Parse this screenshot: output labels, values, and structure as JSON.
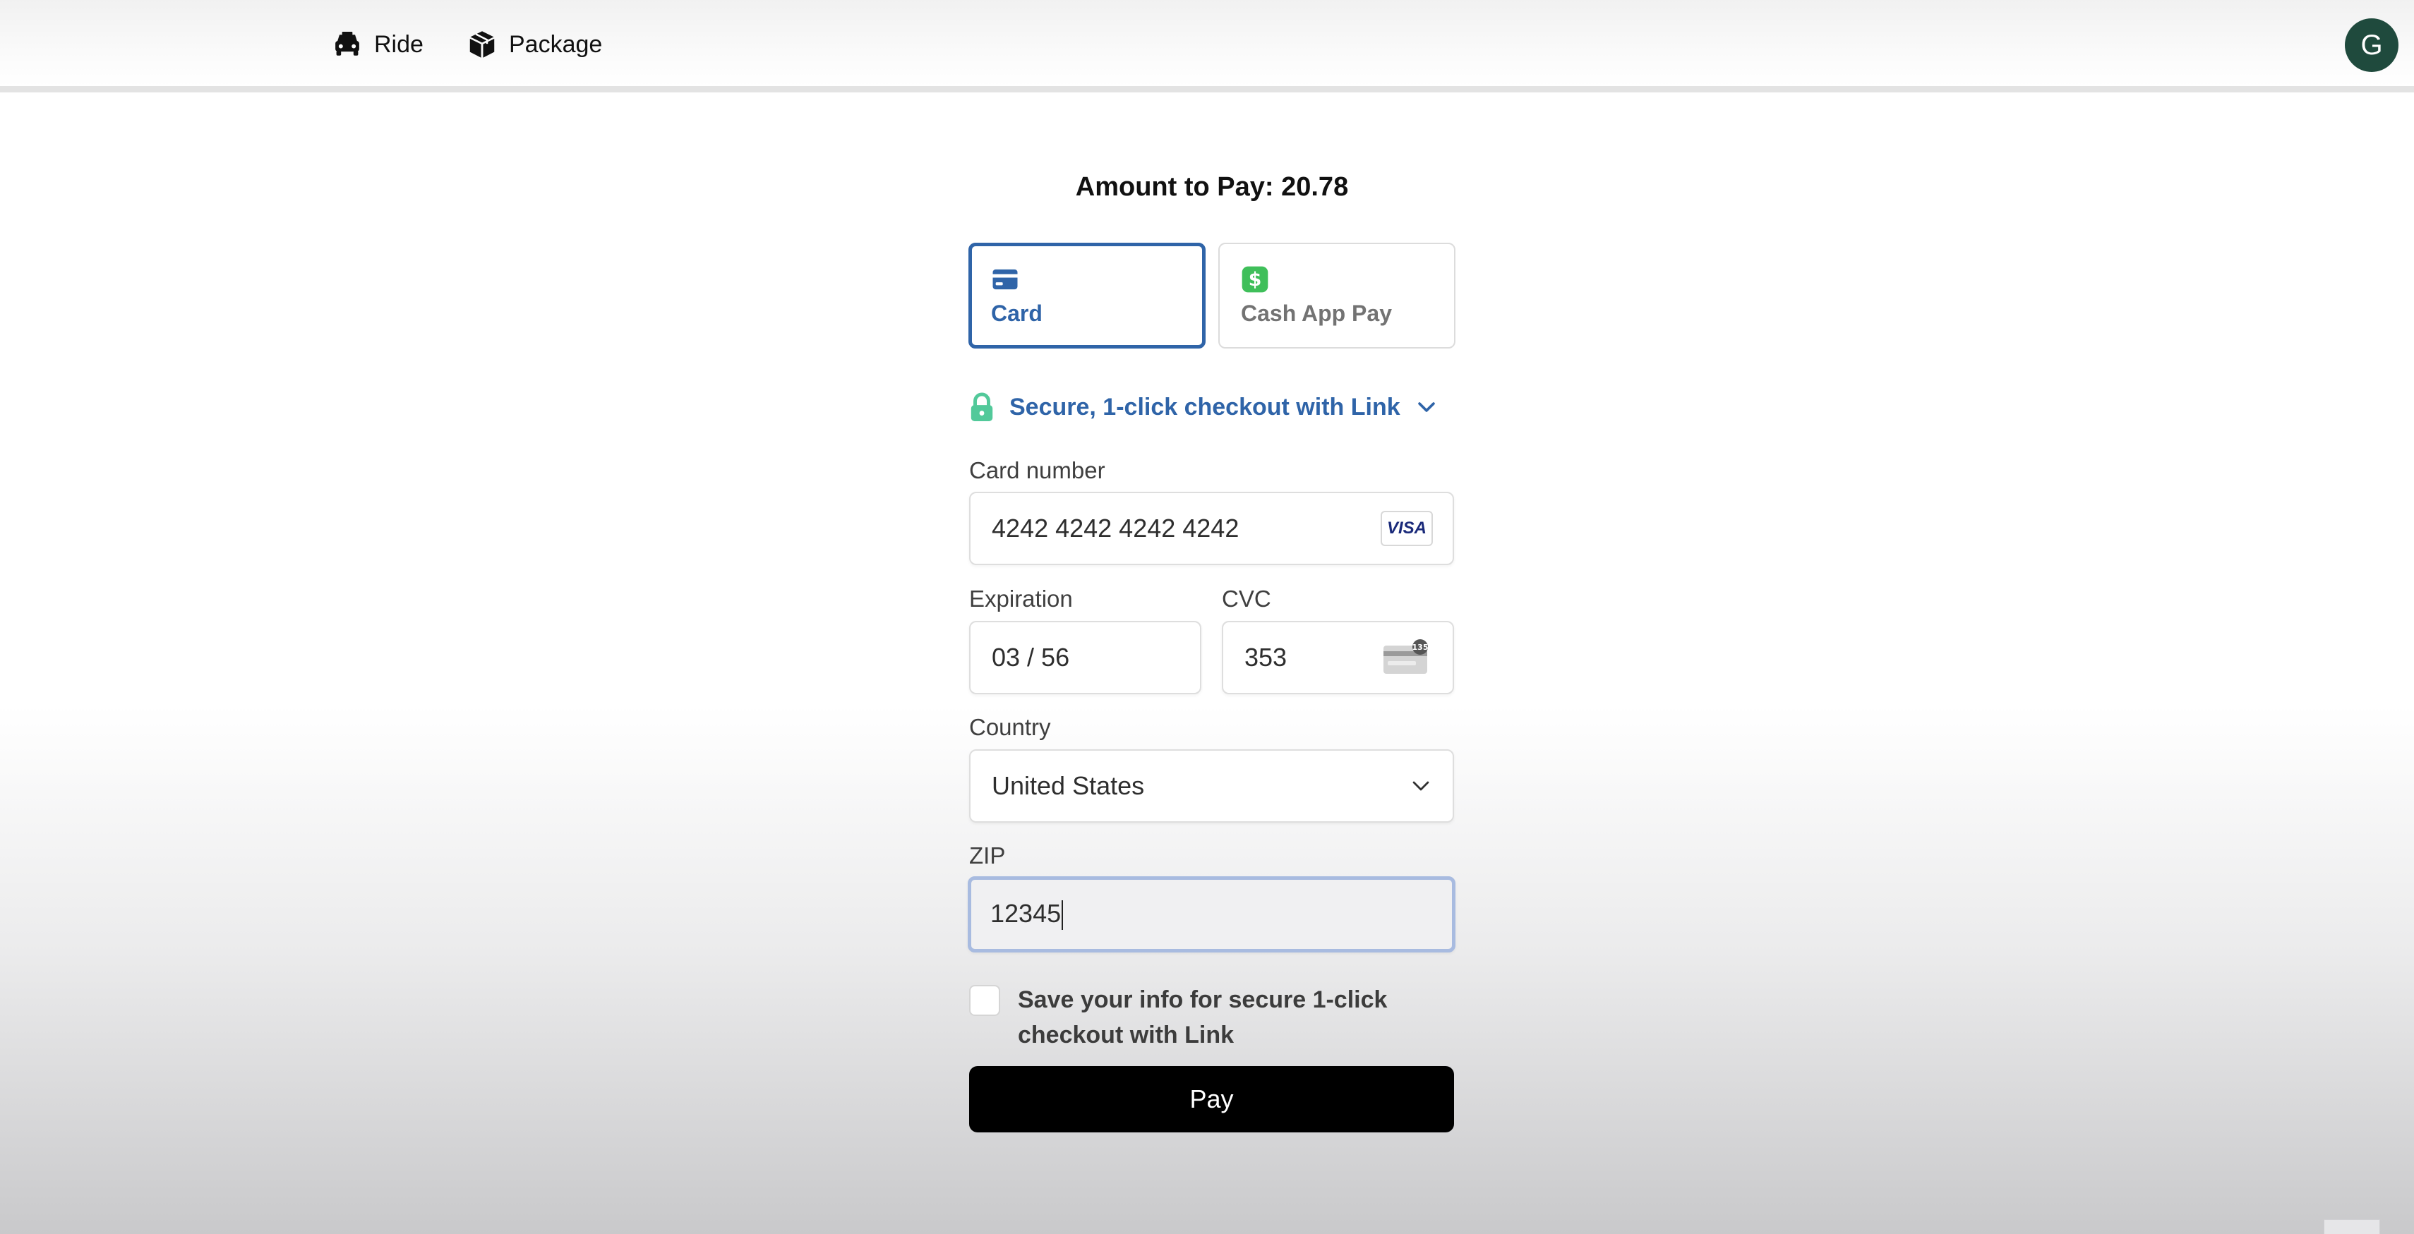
{
  "nav": {
    "items": [
      {
        "label": "Ride",
        "icon": "car-icon"
      },
      {
        "label": "Package",
        "icon": "package-icon"
      }
    ],
    "avatar_initial": "G"
  },
  "payment": {
    "amount_text": "Amount to Pay: 20.78",
    "methods": [
      {
        "label": "Card",
        "icon": "card-icon",
        "selected": true
      },
      {
        "label": "Cash App Pay",
        "icon": "cash-app-icon",
        "selected": false
      }
    ],
    "link_text": "Secure, 1-click checkout with Link",
    "card_number": {
      "label": "Card number",
      "value": "4242 4242 4242 4242",
      "brand": "VISA"
    },
    "expiration": {
      "label": "Expiration",
      "value": "03 / 56"
    },
    "cvc": {
      "label": "CVC",
      "value": "353",
      "hint": "135"
    },
    "country": {
      "label": "Country",
      "value": "United States"
    },
    "zip": {
      "label": "ZIP",
      "value": "12345"
    },
    "save_info_text": "Save your info for secure 1-click checkout with Link",
    "pay_label": "Pay"
  },
  "colors": {
    "accent": "#2f64a8",
    "avatar_bg": "#1f4a3d",
    "cash_app_green": "#3fbf5a",
    "link_lock": "#52c99a",
    "pay_button": "#000000"
  }
}
